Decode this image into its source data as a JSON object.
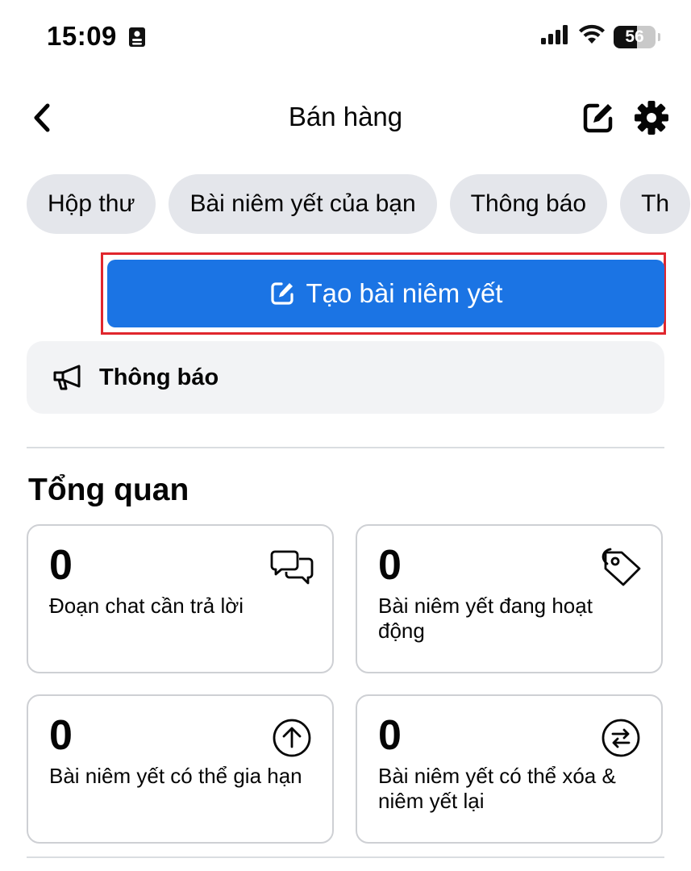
{
  "status_bar": {
    "time": "15:09",
    "battery": "56"
  },
  "header": {
    "title": "Bán hàng"
  },
  "tabs": [
    {
      "label": "Hộp thư"
    },
    {
      "label": "Bài niêm yết của bạn"
    },
    {
      "label": "Thông báo"
    },
    {
      "label": "Th"
    }
  ],
  "create_button": {
    "label": "Tạo bài niêm yết"
  },
  "notice": {
    "label": "Thông báo"
  },
  "overview": {
    "title": "Tổng quan",
    "cards": [
      {
        "value": "0",
        "label": "Đoạn chat cần trả lời",
        "icon": "chat-bubbles-icon"
      },
      {
        "value": "0",
        "label": "Bài niêm yết đang hoạt động",
        "icon": "tag-icon"
      },
      {
        "value": "0",
        "label": "Bài niêm yết có thể gia hạn",
        "icon": "arrow-up-circle-icon"
      },
      {
        "value": "0",
        "label": "Bài niêm yết có thể xóa & niêm yết lại",
        "icon": "swap-arrows-circle-icon"
      }
    ]
  }
}
